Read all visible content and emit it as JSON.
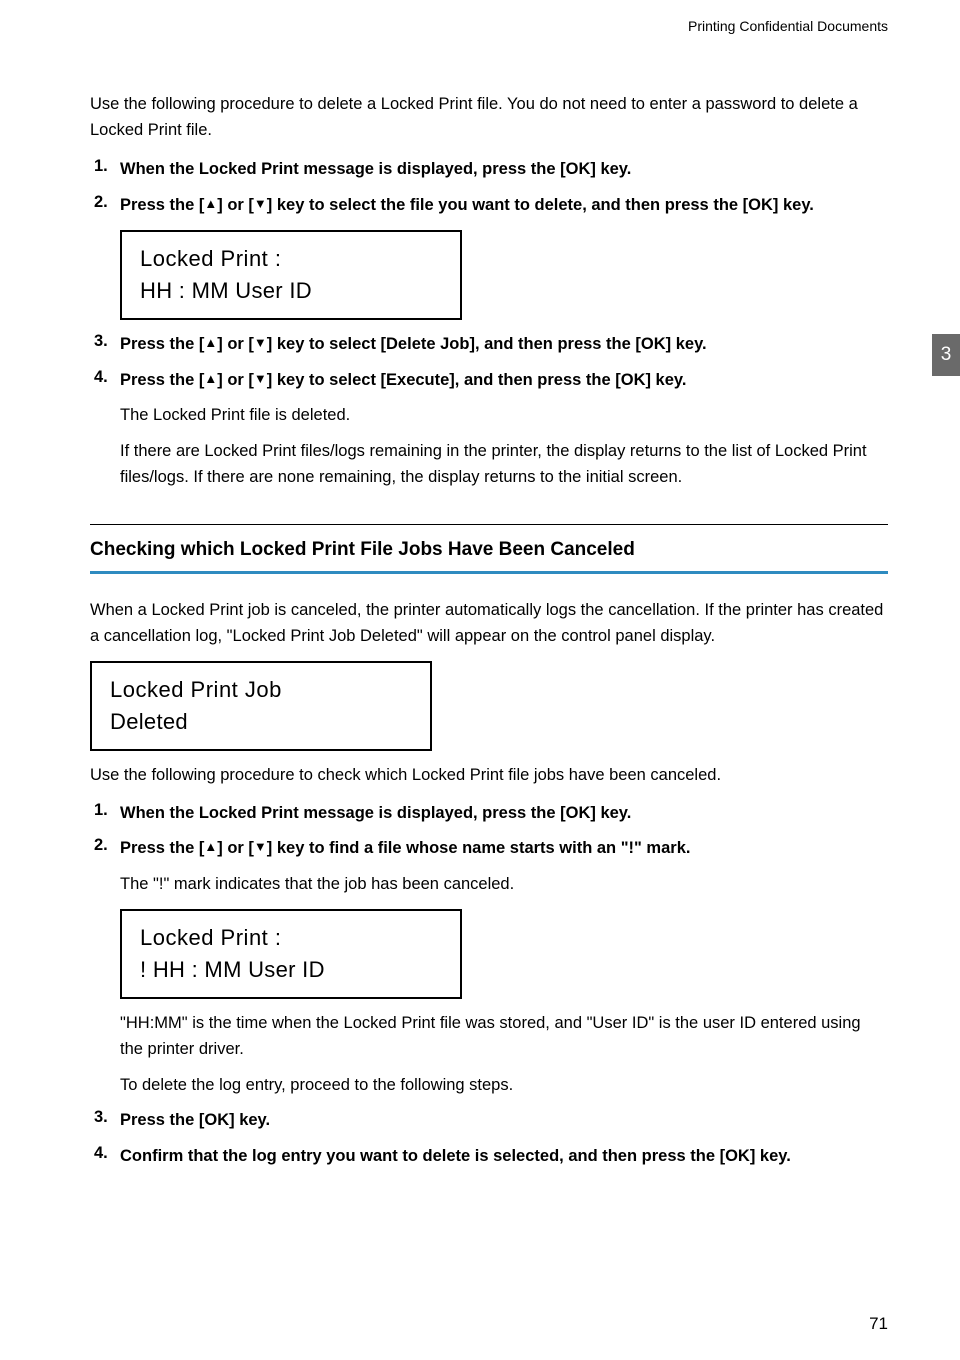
{
  "header": {
    "title": "Printing Confidential Documents"
  },
  "intro": "Use the following procedure to delete a Locked Print file. You do not need to enter a password to delete a Locked Print file.",
  "list1": {
    "items": [
      {
        "num": "1.",
        "bold": "When the Locked Print message is displayed, press the [OK] key."
      },
      {
        "num": "2.",
        "bold_pre": "Press the [",
        "bold_mid": "] or [",
        "bold_post": "] key to select the file you want to delete, and then press the [OK] key."
      },
      {
        "num": "3.",
        "bold_pre": "Press the [",
        "bold_mid": "] or [",
        "bold_post": "] key to select [Delete Job], and then press the [OK] key."
      },
      {
        "num": "4.",
        "bold_pre": "Press the [",
        "bold_mid": "] or [",
        "bold_post": "] key to select [Execute], and then press the [OK] key.",
        "plain1": "The Locked Print file is deleted.",
        "plain2": "If there are Locked Print files/logs remaining in the printer, the display returns to the list of Locked Print files/logs. If there are none remaining, the display returns to the initial screen."
      }
    ]
  },
  "display1": {
    "line1": "Locked  Print :",
    "line2": "HH : MM  User ID"
  },
  "section": {
    "heading": "Checking which Locked Print File Jobs Have Been Canceled",
    "para1": "When a Locked Print job is canceled, the printer automatically logs the cancellation. If the printer has created a cancellation log, \"Locked Print Job Deleted\" will appear on the control panel display.",
    "para2": "Use the following procedure to check which Locked Print file jobs have been canceled."
  },
  "display2": {
    "line1": "Locked  Print  Job",
    "line2": "Deleted"
  },
  "list2": {
    "items": [
      {
        "num": "1.",
        "bold": "When the Locked Print message is displayed, press the [OK] key."
      },
      {
        "num": "2.",
        "bold_pre": "Press the [",
        "bold_mid": "] or [",
        "bold_post": "] key to find a file whose name starts with an \"!\" mark.",
        "plain1": "The \"!\" mark indicates that the job has been canceled.",
        "plain2": "\"HH:MM\" is the time when the Locked Print file was stored, and \"User ID\" is the user ID entered using the printer driver.",
        "plain3": "To delete the log entry, proceed to the following steps."
      },
      {
        "num": "3.",
        "bold": "Press the [OK] key."
      },
      {
        "num": "4.",
        "bold": "Confirm that the log entry you want to delete is selected, and then press the [OK] key."
      }
    ]
  },
  "display3": {
    "line1": "Locked  Print :",
    "line2": "! HH : MM  User ID"
  },
  "chapter_tab": "3",
  "page_number": "71"
}
